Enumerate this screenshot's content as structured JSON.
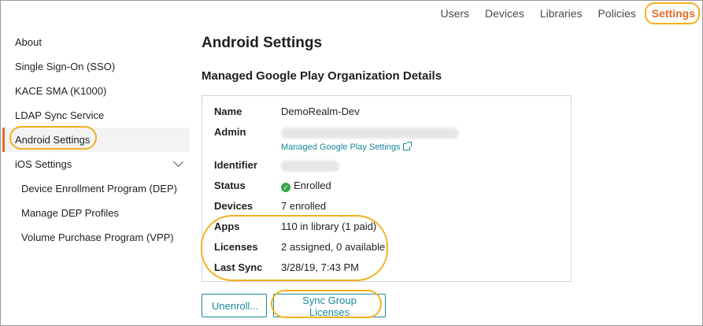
{
  "topnav": {
    "items": [
      "Users",
      "Devices",
      "Libraries",
      "Policies",
      "Settings"
    ],
    "active": "Settings"
  },
  "sidebar": {
    "items": [
      {
        "label": "About"
      },
      {
        "label": "Single Sign-On (SSO)"
      },
      {
        "label": "KACE SMA (K1000)"
      },
      {
        "label": "LDAP Sync Service"
      },
      {
        "label": "Android Settings"
      },
      {
        "label": "iOS Settings"
      },
      {
        "label": "Device Enrollment Program (DEP)"
      },
      {
        "label": "Manage DEP Profiles"
      },
      {
        "label": "Volume Purchase Program (VPP)"
      }
    ]
  },
  "main": {
    "title": "Android Settings",
    "section_title": "Managed Google Play Organization Details",
    "details": {
      "name_label": "Name",
      "name_value": "DemoRealm-Dev",
      "admin_label": "Admin",
      "admin_link": "Managed Google Play Settings",
      "identifier_label": "Identifier",
      "status_label": "Status",
      "status_value": "Enrolled",
      "devices_label": "Devices",
      "devices_value": "7 enrolled",
      "apps_label": "Apps",
      "apps_value": "110 in library (1 paid)",
      "licenses_label": "Licenses",
      "licenses_value": "2 assigned, 0 available",
      "last_sync_label": "Last Sync",
      "last_sync_value": "3/28/19, 7:43 PM"
    },
    "buttons": {
      "unenroll": "Unenroll...",
      "sync": "Sync Group Licenses"
    }
  },
  "colors": {
    "accent": "#e36b2c",
    "link": "#1a8a99",
    "highlight": "#f2b01e",
    "success": "#3aa54a"
  }
}
